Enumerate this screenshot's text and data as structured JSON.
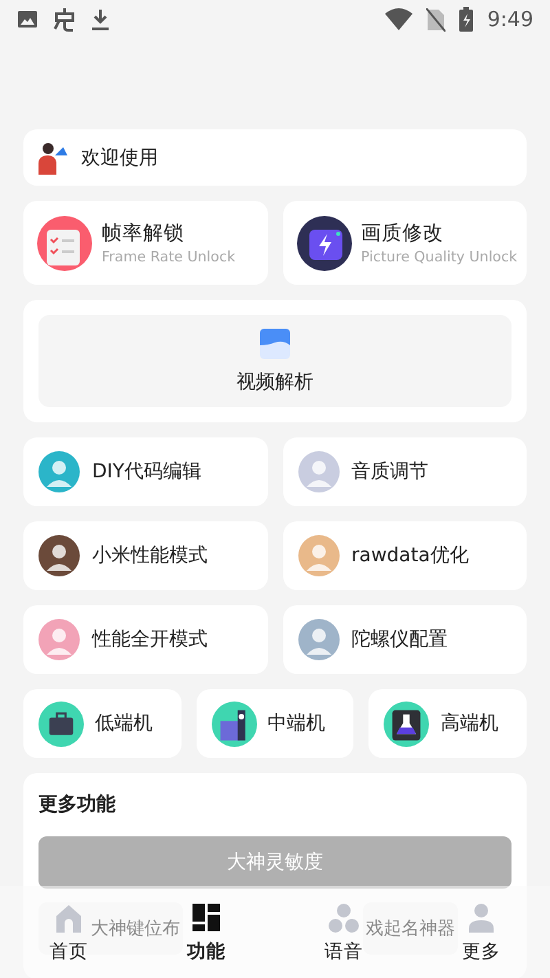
{
  "status_bar": {
    "time": "9:49"
  },
  "welcome": {
    "text": "欢迎使用"
  },
  "features": [
    {
      "title": "帧率解锁",
      "subtitle": "Frame Rate Unlock",
      "kind": "checklist"
    },
    {
      "title": "画质修改",
      "subtitle": "Picture Quality Unlock",
      "kind": "bolt"
    }
  ],
  "video": {
    "label": "视频解析"
  },
  "tools": [
    {
      "label": "DIY代码编辑"
    },
    {
      "label": "音质调节"
    },
    {
      "label": "小米性能模式"
    },
    {
      "label": "rawdata优化"
    },
    {
      "label": "性能全开模式"
    },
    {
      "label": "陀螺仪配置"
    }
  ],
  "devices": [
    {
      "label": "低端机",
      "kind": "briefcase"
    },
    {
      "label": "中端机",
      "kind": "building"
    },
    {
      "label": "高端机",
      "kind": "flask"
    }
  ],
  "more": {
    "title": "更多功能",
    "buttons": [
      {
        "label": "大神灵敏度",
        "kind": "primary"
      },
      {
        "label": "大神键位布",
        "kind": "secondary"
      },
      {
        "label": "戏起名神器",
        "kind": "secondary"
      }
    ]
  },
  "nav": [
    {
      "label": "首页",
      "kind": "home",
      "selected": false
    },
    {
      "label": "功能",
      "kind": "grid",
      "selected": true
    },
    {
      "label": "语音",
      "kind": "circles",
      "selected": false
    },
    {
      "label": "更多",
      "kind": "person",
      "selected": false
    }
  ]
}
